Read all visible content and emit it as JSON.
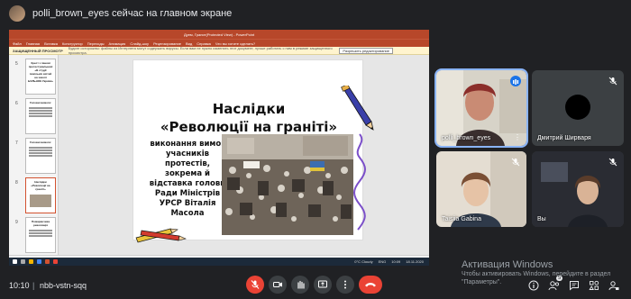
{
  "topbar": {
    "presenting_text": "polli_brown_eyes сейчас на главном экране"
  },
  "powerpoint": {
    "window_title": "Дуем, Гранит(Protected View) - PowerPoint",
    "ribbon_tabs": [
      "Файл",
      "Главная",
      "Вставка",
      "Конструктор",
      "Переходы",
      "Анимация",
      "Слайд-шоу",
      "Рецензирование",
      "Вид",
      "Справка",
      "Что вы хотите сделать?"
    ],
    "protected_label": "ЗАЩИЩЕННЫЙ ПРОСМОТР",
    "protected_message": "Будьте осторожны: файлы из Интернета могут содержать вирусы. Если вам не нужно изменять этот документ, лучше работать с ним в режиме защищенного просмотра.",
    "enable_editing": "Разрешить редактирование",
    "thumbnails": [
      {
        "num": "5",
        "text": "Хрест з панові протестувальникі «В студії повільніх вістей на захопі БОЛЬНОЕ Україні»"
      },
      {
        "num": "6",
        "text": "Головні вимоги:"
      },
      {
        "num": "7",
        "text": "Головні вимоги:"
      },
      {
        "num": "8",
        "text": "Наслідки «Революції на граніті»"
      },
      {
        "num": "9",
        "text": "Помаранчева революція"
      }
    ],
    "slide": {
      "title_line1": "Наслідки",
      "title_line2": "«Революції на граніті»",
      "body": "виконання вимог учасників протестів, зокрема й відставка голови Ради Міністрів УРСР Віталія Масола"
    },
    "status": [
      "Слайд 8 из 10",
      "русский (Россия)",
      "Заметки",
      "Примечания"
    ],
    "taskbar_weather": "0°C Cloudy",
    "taskbar_lang": "ENG",
    "taskbar_time": "10:09",
    "taskbar_date": "18.11.2020"
  },
  "participants": [
    {
      "name": "polli_brown_eyes",
      "muted": false
    },
    {
      "name": "Дмитрий Ширваря",
      "muted": true
    },
    {
      "name": "Taisiia Gabina",
      "muted": true
    },
    {
      "name": "Вы",
      "muted": true
    }
  ],
  "watermark": {
    "title": "Активация Windows",
    "line1": "Чтобы активировать Windows, перейдите в раздел",
    "line2": "\"Параметры\"."
  },
  "bottom": {
    "time": "10:10",
    "separator": "|",
    "meeting_code": "nbb-vstn-sqq",
    "people_badge": "5"
  },
  "colors": {
    "background": "#202124",
    "tile": "#3c4043",
    "accent_red": "#ea4335",
    "powerpoint_red": "#b7472a",
    "active_speaker": "#8ab4f8"
  }
}
